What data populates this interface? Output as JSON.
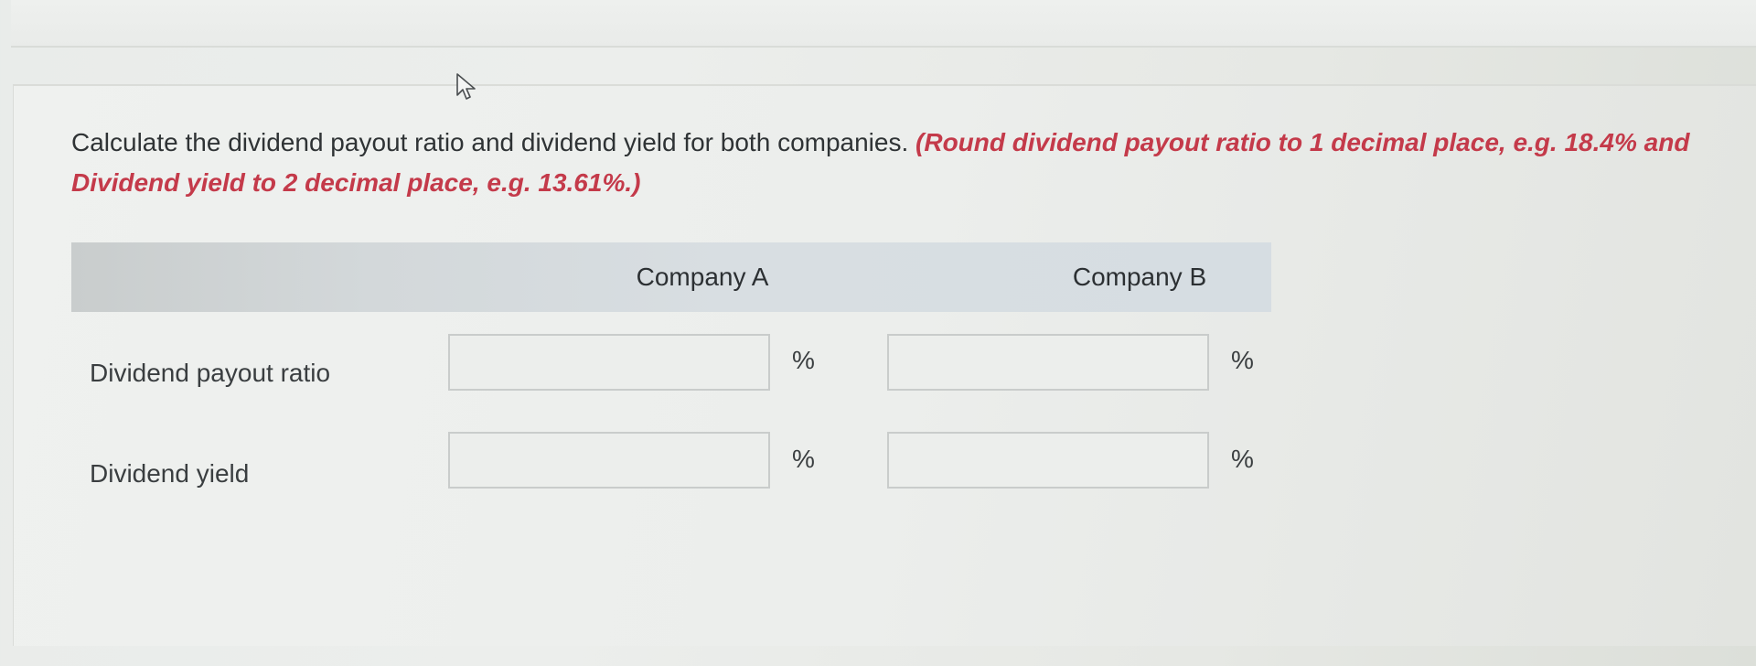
{
  "question": {
    "text": "Calculate the dividend payout ratio and dividend yield for both companies. ",
    "hint": "(Round dividend payout ratio to 1 decimal place, e.g. 18.4% and Dividend yield to 2 decimal place, e.g. 13.61%.)"
  },
  "table": {
    "columns": [
      "Company A",
      "Company B"
    ],
    "rows": [
      {
        "label": "Dividend payout ratio",
        "unit": "%",
        "values": [
          "",
          ""
        ]
      },
      {
        "label": "Dividend yield",
        "unit": "%",
        "values": [
          "",
          ""
        ]
      }
    ]
  },
  "colors": {
    "hint": "#c43a4a",
    "header_bg": "#d6dde2",
    "text": "#2f3335"
  },
  "icons": {
    "cursor": "mouse-pointer-icon"
  }
}
